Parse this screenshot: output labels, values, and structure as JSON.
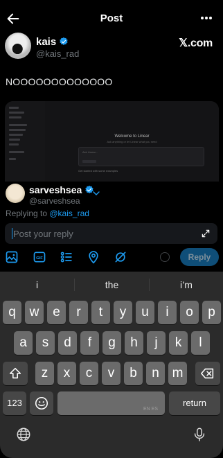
{
  "header": {
    "title": "Post",
    "back_icon": "arrow-left-icon",
    "more_icon": "more-horizontal-icon"
  },
  "post": {
    "author_name": "kais",
    "author_handle": "@kais_rad",
    "source_label": "𝕏.com",
    "text": "NOOOOOOOOOOOOO",
    "media": {
      "sidebar_items": [
        "Inbox",
        "My issues",
        "Drafts",
        "Workspace",
        "Initiatives",
        "Projects",
        "Views",
        "More",
        "Your teams",
        "Try"
      ],
      "welcome_title": "Welcome to Linear",
      "welcome_subtitle": "Ask anything or let Linear what you need",
      "command_placeholder": "Ask Linear...",
      "command_row": "Get started with some examples"
    }
  },
  "reply": {
    "user_name": "sarveshsea",
    "user_handle": "@sarveshsea",
    "replying_prefix": "Replying to ",
    "replying_handle": "@kais_rad",
    "placeholder": "Post your reply",
    "button_label": "Reply",
    "tools": [
      "image-icon",
      "gif-icon",
      "poll-icon",
      "location-icon",
      "no-signal-icon"
    ]
  },
  "keyboard": {
    "suggestions": [
      "i",
      "the",
      "i’m"
    ],
    "row1": [
      "q",
      "w",
      "e",
      "r",
      "t",
      "y",
      "u",
      "i",
      "o",
      "p"
    ],
    "row2": [
      "a",
      "s",
      "d",
      "f",
      "g",
      "h",
      "j",
      "k",
      "l"
    ],
    "row3": [
      "z",
      "x",
      "c",
      "v",
      "b",
      "n",
      "m"
    ],
    "numbers_label": "123",
    "space_label": "EN ES",
    "return_label": "return"
  },
  "colors": {
    "accent": "#1d9bf0",
    "background": "#000000",
    "keyboard": "#2b2b2b"
  }
}
